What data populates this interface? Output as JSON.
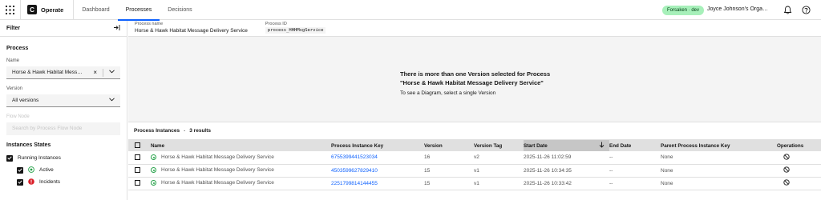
{
  "app": {
    "name": "Operate",
    "logo_letter": "C"
  },
  "nav": {
    "tabs": [
      "Dashboard",
      "Processes",
      "Decisions"
    ],
    "active": "Processes"
  },
  "topbar": {
    "env_tag": "Forsaken · dev",
    "org_name": "Joyce Johnson's Orga…"
  },
  "filter": {
    "title": "Filter",
    "process_section": "Process",
    "name_label": "Name",
    "name_value": "Horse & Hawk Habitat Mess…",
    "version_label": "Version",
    "version_value": "All versions",
    "flow_node_label": "Flow Node",
    "flow_node_placeholder": "Search by Process Flow Node",
    "states_title": "Instances States",
    "running_label": "Running Instances",
    "active_label": "Active",
    "incidents_label": "Incidents"
  },
  "process_header": {
    "name_label": "Process name",
    "name_value": "Horse & Hawk Habitat Message Delivery Service",
    "id_label": "Process ID",
    "id_value": "process_HHHMsgService"
  },
  "diagram": {
    "title": "There is more than one Version selected for Process \"Horse & Hawk Habitat Message Delivery Service\"",
    "subtitle": "To see a Diagram, select a single Version"
  },
  "instances": {
    "title": "Process Instances",
    "sep": "-",
    "count": "3 results",
    "columns": [
      "Name",
      "Process Instance Key",
      "Version",
      "Version Tag",
      "Start Date",
      "End Date",
      "Parent Process Instance Key",
      "Operations"
    ],
    "rows": [
      {
        "name": "Horse & Hawk Habitat Message Delivery Service",
        "key": "6755399441523034",
        "version": "16",
        "tag": "v2",
        "start": "2025-11-26 11:02:59",
        "end": "--",
        "parent": "None"
      },
      {
        "name": "Horse & Hawk Habitat Message Delivery Service",
        "key": "4503599627829410",
        "version": "15",
        "tag": "v1",
        "start": "2025-11-26 10:34:35",
        "end": "--",
        "parent": "None"
      },
      {
        "name": "Horse & Hawk Habitat Message Delivery Service",
        "key": "2251799814144455",
        "version": "15",
        "tag": "v1",
        "start": "2025-11-26 10:33:42",
        "end": "--",
        "parent": "None"
      }
    ]
  },
  "colors": {
    "accent": "#0f62fe",
    "success": "#24a148",
    "danger": "#da1e28",
    "env_tag_bg": "#a7f0ba"
  }
}
